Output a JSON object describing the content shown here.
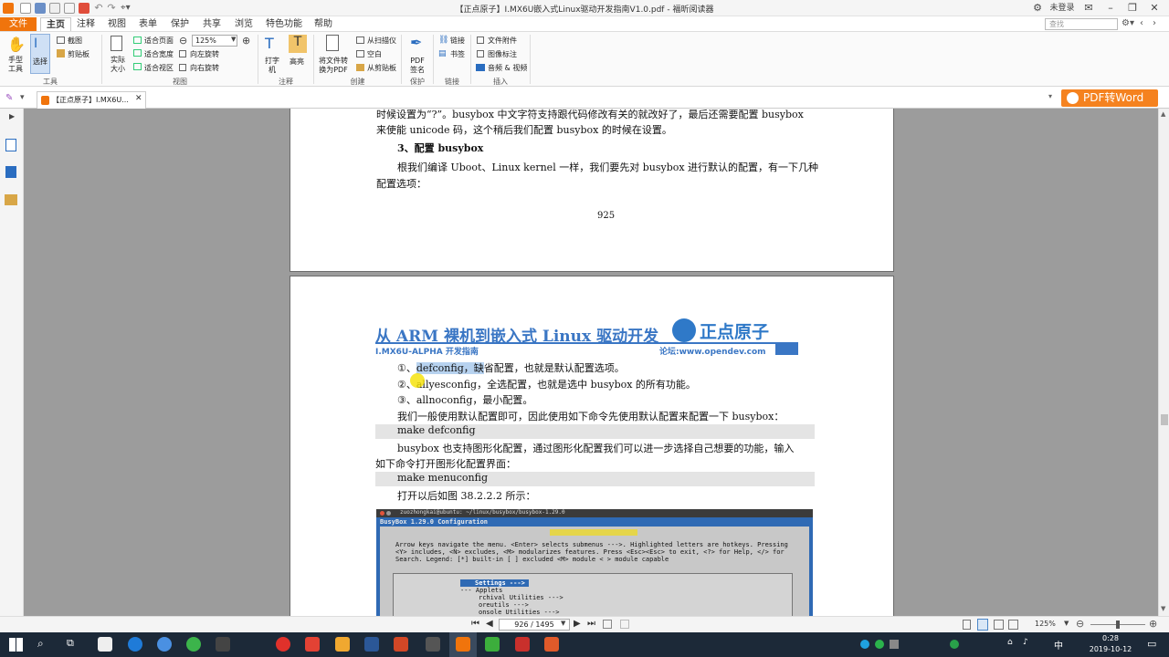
{
  "window": {
    "title": "【正点原子】I.MX6U嵌入式Linux驱动开发指南V1.0.pdf - 福昕阅读器",
    "login": "未登录",
    "search_placeholder": "查找"
  },
  "menu": {
    "file": "文件",
    "home": "主页",
    "annotate": "注释",
    "view": "视图",
    "form": "表单",
    "protect": "保护",
    "share": "共享",
    "browse": "浏览",
    "features": "特色功能",
    "help": "帮助"
  },
  "ribbon": {
    "hand": "手型工具",
    "select": "选择",
    "snapshot": "截图",
    "clipboard": "剪贴板",
    "tools_group": "工具",
    "actual_size": "实际大小",
    "fit_page": "适合页面",
    "fit_width": "适合宽度",
    "fit_visible": "适合视区",
    "zoom": "125%",
    "rotate_left": "向左旋转",
    "rotate_right": "向右旋转",
    "view_group": "视图",
    "typewriter": "打字机",
    "highlight": "高亮",
    "annotate_group": "注释",
    "to_pdf": "将文件转换为PDF",
    "from_scanner": "从扫描仪",
    "blank": "空白",
    "from_clipboard": "从剪贴板",
    "create_group": "创建",
    "pdf_sign": "PDF签名",
    "protect_group": "保护",
    "link": "链接",
    "bookmark": "书签",
    "link_group": "链接",
    "file_attach": "文件附件",
    "image_annot": "图像标注",
    "audio_video": "音频 & 视频",
    "insert_group": "插入"
  },
  "tab": {
    "doc": "【正点原子】I.MX6U...",
    "pdf_to_word": "PDF转Word"
  },
  "page925": {
    "line1": "时候设置为“?”。busybox 中文字符支持跟代码修改有关的就改好了，最后还需要配置 busybox",
    "line2": "来使能 unicode 码，这个稍后我们配置 busybox 的时候在设置。",
    "heading": "3、配置 busybox",
    "para1": "根我们编译 Uboot、Linux kernel 一样，我们要先对 busybox 进行默认的配置，有一下几种",
    "para2": "配置选项：",
    "page_number": "925"
  },
  "page926": {
    "header_title": "从 ARM 裸机到嵌入式 Linux 驱动开发",
    "header_sub": "I.MX6U-ALPHA 开发指南",
    "logo_text": "正点原子",
    "forum": "论坛:www.opendev.com",
    "item1_prefix": "①、",
    "item1_hl": "defconfig，缺",
    "item1_rest": "省配置，也就是默认配置选项。",
    "item2_prefix": "②、",
    "item2_rest": "allyesconfig，全选配置，也就是选中 busybox 的所有功能。",
    "item3": "③、allnoconfig，最小配置。",
    "para1": "我们一般使用默认配置即可，因此使用如下命令先使用默认配置来配置一下 busybox：",
    "code1": "make defconfig",
    "para2a": "busybox 也支持图形化配置，通过图形化配置我们可以进一步选择自己想要的功能，输入",
    "para2b": "如下命令打开图形化配置界面：",
    "code2": "make menuconfig",
    "para3": "打开以后如图 38.2.2.2 所示："
  },
  "terminal": {
    "title": "zuozhongkai@ubuntu: ~/linux/busybox/busybox-1.29.0",
    "config_title": "BusyBox 1.29.0 Configuration",
    "help1": "Arrow keys navigate the menu.  <Enter> selects submenus --->.  Highlighted letters are hotkeys.  Pressing",
    "help2": "<Y> includes, <N> excludes, <M> modularizes features.  Press <Esc><Esc> to exit, <?> for Help, </> for",
    "help3": "Search.  Legend: [*] built-in  [ ] excluded  <M> module  < > module capable",
    "items": [
      "Settings  --->",
      "--- Applets",
      "rchival Utilities  --->",
      "oreutils  --->",
      "onsole Utilities  --->"
    ]
  },
  "status": {
    "page_value": "926 / 1495",
    "zoom": "125%"
  },
  "taskbar": {
    "time": "0:28",
    "date": "2019-10-12",
    "ime": "中"
  }
}
